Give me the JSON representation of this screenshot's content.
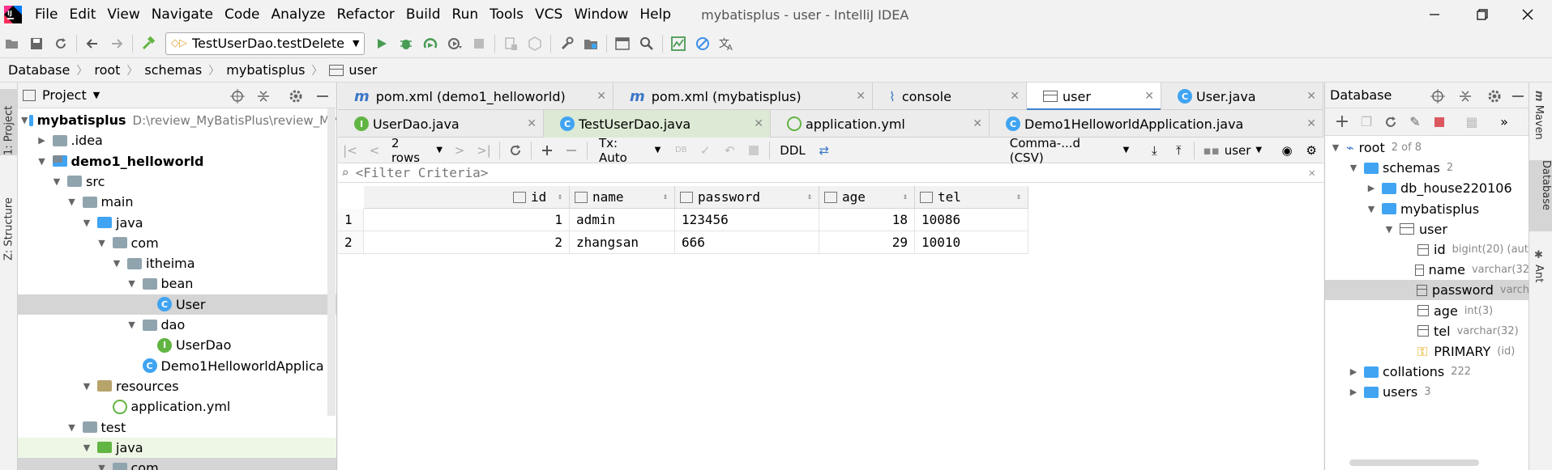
{
  "menu": {
    "items": [
      "File",
      "Edit",
      "View",
      "Navigate",
      "Code",
      "Analyze",
      "Refactor",
      "Build",
      "Run",
      "Tools",
      "VCS",
      "Window",
      "Help"
    ],
    "window_title": "mybatisplus - user - IntelliJ IDEA"
  },
  "toolbar": {
    "run_config": "TestUserDao.testDelete"
  },
  "breadcrumb": [
    "Database",
    "root",
    "schemas",
    "mybatisplus",
    "user"
  ],
  "left_strip": {
    "project_tab": "1: Project",
    "structure_tab": "Z: Structure"
  },
  "project": {
    "title": "Project",
    "tree": [
      {
        "label": "mybatisplus",
        "hint": "D:\\review_MyBatisPlus\\review_My",
        "indent": 0,
        "arrow": "▼",
        "type": "module",
        "bold": true
      },
      {
        "label": ".idea",
        "indent": 1,
        "arrow": "▶",
        "type": "folder"
      },
      {
        "label": "demo1_helloworld",
        "indent": 1,
        "arrow": "▼",
        "type": "module",
        "bold": true
      },
      {
        "label": "src",
        "indent": 2,
        "arrow": "▼",
        "type": "folder"
      },
      {
        "label": "main",
        "indent": 3,
        "arrow": "▼",
        "type": "folder"
      },
      {
        "label": "java",
        "indent": 4,
        "arrow": "▼",
        "type": "folder-blue"
      },
      {
        "label": "com",
        "indent": 5,
        "arrow": "▼",
        "type": "folder"
      },
      {
        "label": "itheima",
        "indent": 6,
        "arrow": "▼",
        "type": "folder"
      },
      {
        "label": "bean",
        "indent": 7,
        "arrow": "▼",
        "type": "folder"
      },
      {
        "label": "User",
        "indent": 8,
        "arrow": "",
        "type": "class",
        "selected": true
      },
      {
        "label": "dao",
        "indent": 7,
        "arrow": "▼",
        "type": "folder"
      },
      {
        "label": "UserDao",
        "indent": 8,
        "arrow": "",
        "type": "interface"
      },
      {
        "label": "Demo1HelloworldApplica",
        "indent": 7,
        "arrow": "",
        "type": "class"
      },
      {
        "label": "resources",
        "indent": 4,
        "arrow": "▼",
        "type": "folder-res"
      },
      {
        "label": "application.yml",
        "indent": 5,
        "arrow": "",
        "type": "yml"
      },
      {
        "label": "test",
        "indent": 3,
        "arrow": "▼",
        "type": "folder"
      },
      {
        "label": "java",
        "indent": 4,
        "arrow": "▼",
        "type": "folder-green",
        "green": true
      },
      {
        "label": "com",
        "indent": 5,
        "arrow": "▼",
        "type": "folder",
        "selected": true
      }
    ]
  },
  "editor": {
    "tabs_row1": [
      {
        "label": "pom.xml (demo1_helloworld)",
        "icon": "m",
        "width": 340
      },
      {
        "label": "pom.xml (mybatisplus)",
        "icon": "m",
        "width": 320
      },
      {
        "label": "console",
        "icon": "console",
        "width": 190
      },
      {
        "label": "user",
        "icon": "table",
        "width": 166,
        "active": true
      },
      {
        "label": "User.java",
        "icon": "class",
        "width": 200
      }
    ],
    "tabs_row2": [
      {
        "label": "UserDao.java",
        "icon": "interface",
        "width": 254
      },
      {
        "label": "TestUserDao.java",
        "icon": "class",
        "width": 280,
        "selected": true
      },
      {
        "label": "application.yml",
        "icon": "yml",
        "width": 270
      },
      {
        "label": "Demo1HelloworldApplication.java",
        "icon": "class",
        "width": 412
      }
    ]
  },
  "grid_toolbar": {
    "rows": "2 rows",
    "tx": "Tx: Auto",
    "ddl": "DDL",
    "format": "Comma-...d (CSV)",
    "schema": "user"
  },
  "filter": {
    "placeholder": "<Filter Criteria>"
  },
  "table": {
    "columns": [
      {
        "name": "id",
        "width": 254,
        "key": true
      },
      {
        "name": "name",
        "width": 130
      },
      {
        "name": "password",
        "width": 178
      },
      {
        "name": "age",
        "width": 118
      },
      {
        "name": "tel",
        "width": 140
      }
    ],
    "rows": [
      {
        "num": "1",
        "cells": [
          "1",
          "admin",
          "123456",
          "18",
          "10086"
        ]
      },
      {
        "num": "2",
        "cells": [
          "2",
          "zhangsan",
          "666",
          "29",
          "10010"
        ]
      }
    ]
  },
  "database": {
    "title": "Database",
    "tree": [
      {
        "label": "root",
        "sub": "2 of 8",
        "indent": 0,
        "arrow": "▼",
        "type": "datasource"
      },
      {
        "label": "schemas",
        "sub": "2",
        "indent": 1,
        "arrow": "▼",
        "type": "folder-blue"
      },
      {
        "label": "db_house220106",
        "sub": "",
        "indent": 2,
        "arrow": "▶",
        "type": "schema"
      },
      {
        "label": "mybatisplus",
        "sub": "",
        "indent": 2,
        "arrow": "▼",
        "type": "schema"
      },
      {
        "label": "user",
        "sub": "",
        "indent": 3,
        "arrow": "▼",
        "type": "table"
      },
      {
        "label": "id",
        "sub": "bigint(20) (aut",
        "indent": 4,
        "arrow": "",
        "type": "column-key"
      },
      {
        "label": "name",
        "sub": "varchar(32",
        "indent": 4,
        "arrow": "",
        "type": "column"
      },
      {
        "label": "password",
        "sub": "varch",
        "indent": 4,
        "arrow": "",
        "type": "column",
        "selected": true
      },
      {
        "label": "age",
        "sub": "int(3)",
        "indent": 4,
        "arrow": "",
        "type": "column"
      },
      {
        "label": "tel",
        "sub": "varchar(32)",
        "indent": 4,
        "arrow": "",
        "type": "column"
      },
      {
        "label": "PRIMARY",
        "sub": "(id)",
        "indent": 4,
        "arrow": "",
        "type": "key"
      },
      {
        "label": "collations",
        "sub": "222",
        "indent": 1,
        "arrow": "▶",
        "type": "folder-blue"
      },
      {
        "label": "users",
        "sub": "3",
        "indent": 1,
        "arrow": "▶",
        "type": "folder-blue"
      }
    ]
  },
  "right_strip": {
    "maven": "Maven",
    "database": "Database",
    "ant": "Ant"
  },
  "colors": {
    "accent": "#4083c9",
    "folder_blue": "#40a4f2",
    "green": "#62b543",
    "run_green": "#499c54",
    "stop_red": "#db5860"
  }
}
